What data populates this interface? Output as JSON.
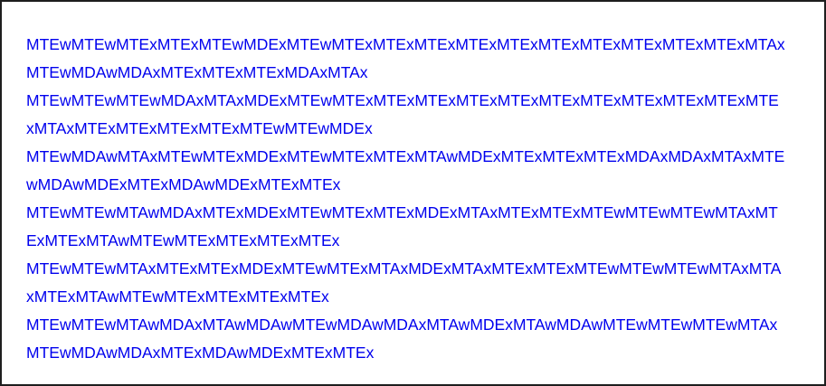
{
  "colors": {
    "link": "#0000ee",
    "border": "#1e1e1e",
    "background": "#ffffff"
  },
  "items": [
    {
      "text": "MTEwMTEwMTExMTExMTEwMDExMTEwMTExMTExMTExMTExMTExMTExMTExMTExMTExMTExMTAxMTEwMDAwMDAxMTExMTExMTExMDAxMTAx"
    },
    {
      "text": "MTEwMTEwMTEwMDAxMTAxMDExMTEwMTExMTExMTExMTExMTExMTExMTExMTExMTExMTExMTExMTAxMTExMTExMTExMTExMTEwMTEwMDEx"
    },
    {
      "text": "MTEwMDAwMTAxMTEwMTExMDExMTEwMTExMTExMTAwMDExMTExMTExMTExMDAxMDAxMTAxMTEwMDAwMDExMTExMDAwMDExMTExMTEx"
    },
    {
      "text": "MTEwMTEwMTAwMDAxMTExMDExMTEwMTExMTExMDExMTAxMTExMTExMTEwMTEwMTEwMTAxMTExMTExMTAwMTEwMTExMTExMTExMTEx"
    },
    {
      "text": "MTEwMTEwMTAxMTExMTExMDExMTEwMTExMTAxMDExMTAxMTExMTExMTEwMTEwMTEwMTAxMTAxMTExMTAwMTEwMTExMTExMTExMTEx"
    },
    {
      "text": "MTEwMTEwMTAwMDAxMTAwMDAwMTEwMDAwMDAxMTAwMDExMTAwMDAwMTEwMTEwMTEwMTAxMTEwMDAwMDAxMTExMDAwMDExMTExMTEx"
    }
  ]
}
